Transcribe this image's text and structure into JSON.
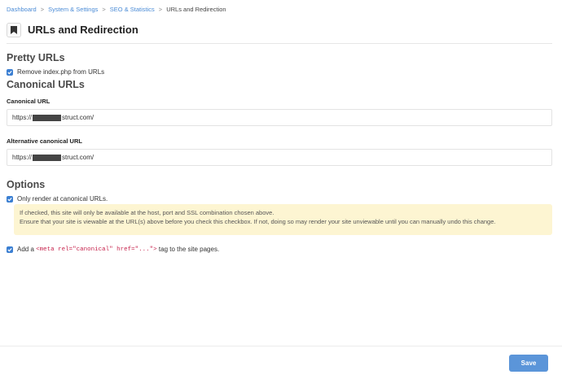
{
  "breadcrumb": {
    "items": [
      "Dashboard",
      "System & Settings",
      "SEO & Statistics"
    ],
    "separator": ">",
    "current": "URLs and Redirection"
  },
  "page": {
    "title": "URLs and Redirection",
    "icon": "bookmark-icon"
  },
  "pretty_urls": {
    "title": "Pretty URLs",
    "remove_index_label": "Remove index.php from URLs",
    "remove_index_checked": true
  },
  "canonical_urls": {
    "title": "Canonical URLs",
    "canonical_label": "Canonical URL",
    "canonical_prefix": "https://",
    "canonical_suffix": "struct.com/",
    "alternative_label": "Alternative canonical URL",
    "alternative_prefix": "https://",
    "alternative_suffix": "struct.com/"
  },
  "options": {
    "title": "Options",
    "only_canonical_label": "Only render at canonical URLs.",
    "only_canonical_checked": true,
    "warning_line1": "If checked, this site will only be available at the host, port and SSL combination chosen above.",
    "warning_line2": "Ensure that your site is viewable at the URL(s) above before you check this checkbox. If not, doing so may render your site unviewable until you can manually undo this change.",
    "meta_prefix": "Add a",
    "meta_code": "<meta rel=\"canonical\" href=\"...\">",
    "meta_suffix": "tag to the site pages.",
    "meta_checked": true
  },
  "footer": {
    "save_label": "Save"
  },
  "colors": {
    "accent": "#3b7fd2",
    "link": "#4a8bd6",
    "warning_bg": "#fdf5d2",
    "button": "#5b95d9",
    "code": "#c7254e"
  }
}
